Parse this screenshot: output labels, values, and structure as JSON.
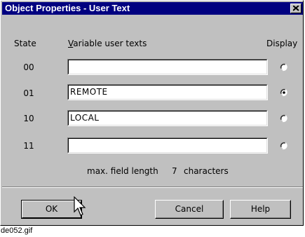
{
  "window": {
    "title": "Object Properties - User Text"
  },
  "headers": {
    "state": "State",
    "variable_prefix": "V",
    "variable_rest": "ariable user texts",
    "display": "Display"
  },
  "rows": [
    {
      "state": "00",
      "value": "",
      "selected": false
    },
    {
      "state": "01",
      "value": "REMOTE",
      "selected": true
    },
    {
      "state": "10",
      "value": "LOCAL",
      "selected": false
    },
    {
      "state": "11",
      "value": "",
      "selected": false
    }
  ],
  "info": {
    "label": "max. field length",
    "value": "7",
    "unit": "characters"
  },
  "buttons": {
    "ok": "OK",
    "cancel": "Cancel",
    "help": "Help"
  },
  "caption": "de052.gif",
  "icons": {
    "close": "close-icon",
    "cursor": "mouse-pointer-icon",
    "radio": "radio-icon"
  },
  "colors": {
    "titlebar": "#000080",
    "face": "#c0c0c0"
  }
}
